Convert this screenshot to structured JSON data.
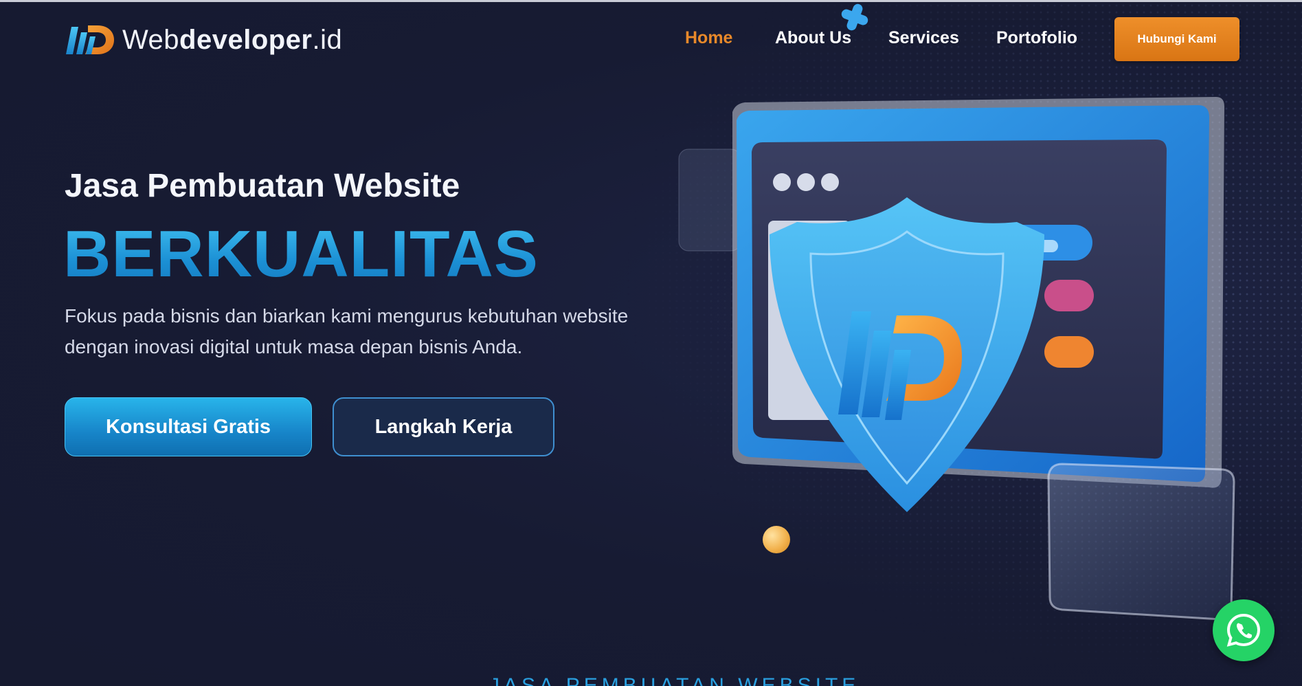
{
  "header": {
    "logo": {
      "text_light": "Web",
      "text_bold": "developer",
      "text_suffix": ".id"
    },
    "nav": [
      {
        "label": "Home",
        "active": true
      },
      {
        "label": "About Us",
        "active": false
      },
      {
        "label": "Services",
        "active": false
      },
      {
        "label": "Portofolio",
        "active": false
      }
    ],
    "cta_label": "Hubungi Kami"
  },
  "hero": {
    "subtitle": "Jasa Pembuatan Website",
    "title": "BERKUALITAS",
    "description": "Fokus pada bisnis dan biarkan kami mengurus kebutuhan website dengan inovasi digital untuk masa depan bisnis Anda.",
    "primary_button": "Konsultasi Gratis",
    "secondary_button": "Langkah Kerja"
  },
  "next_section_label": "JASA PEMBUATAN WEBSITE",
  "colors": {
    "background": "#171b33",
    "accent_orange": "#e8892a",
    "accent_blue": "#1d9ee0",
    "whatsapp_green": "#25d366"
  },
  "icons": [
    "logo-mark-icon",
    "whatsapp-icon",
    "shield-logo-icon"
  ]
}
